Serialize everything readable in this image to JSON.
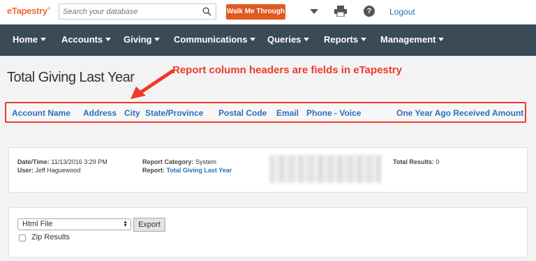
{
  "app": {
    "logo": "eTapestry",
    "logo_mark": "®"
  },
  "search": {
    "placeholder": "Search your database"
  },
  "header": {
    "walk_me_label": "Walk Me Through",
    "logout_label": "Logout",
    "help_glyph": "?"
  },
  "nav": {
    "home": "Home",
    "accounts": "Accounts",
    "giving": "Giving",
    "communications": "Communications",
    "queries": "Queries",
    "reports": "Reports",
    "management": "Management"
  },
  "page": {
    "title": "Total Giving Last Year"
  },
  "annotation": {
    "text": "Report column headers are fields in eTapestry",
    "color": "#ee3a2c"
  },
  "columns": {
    "account_name": "Account Name",
    "address": "Address",
    "city": "City",
    "state": "State/Province",
    "postal": "Postal Code",
    "email": "Email",
    "phone": "Phone - Voice",
    "amount": "One Year Ago Received Amount"
  },
  "report_info": {
    "datetime_label": "Date/Time:",
    "datetime_value": "11/13/2016 3:29 PM",
    "user_label": "User:",
    "user_value": "Jeff Haguewood",
    "category_label": "Report Category:",
    "category_value": "System",
    "report_label": "Report:",
    "report_value": "Total Giving Last Year",
    "results_label": "Total Results:",
    "results_value": "0"
  },
  "export": {
    "format_selected": "Html File",
    "export_label": "Export",
    "zip_label": "Zip Results"
  },
  "colors": {
    "brand": "#ef6c3a",
    "nav_bg": "#3b4a57",
    "link": "#2b6fb6",
    "walk_btn": "#e0591f"
  }
}
